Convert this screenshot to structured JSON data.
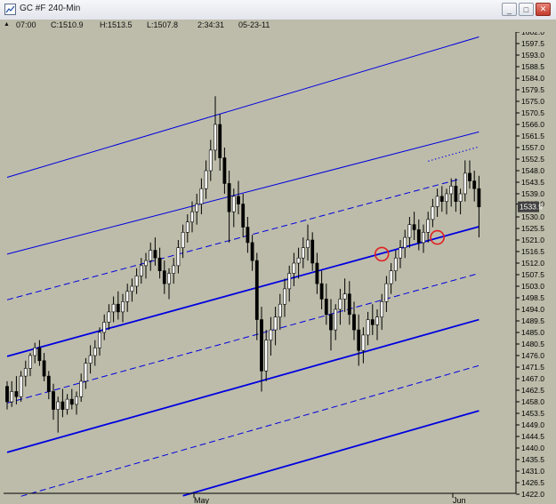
{
  "window": {
    "title": "GC #F 240-Min",
    "buttons": {
      "minimize": "_",
      "maximize": "□",
      "close": "✕"
    }
  },
  "infobar": {
    "time": "07:00",
    "close": "C:1510.9",
    "high": "H:1513.5",
    "low": "L:1507.8",
    "clock": "2:34:31",
    "date": "05-23-11"
  },
  "colors": {
    "background": "#bdbcaa",
    "bars": "#000000",
    "channel": "#0000e0",
    "circles": "#e02020",
    "last_price_box": "#404040"
  },
  "chart_data": {
    "type": "candlestick",
    "symbol": "GC #F",
    "interval": "240-Min",
    "x_labels": [
      "May",
      "Jun"
    ],
    "ylim": [
      1420,
      1604
    ],
    "y_ticks": [
      1602.0,
      1597.5,
      1593.0,
      1588.5,
      1584.0,
      1579.5,
      1575.0,
      1570.5,
      1566.0,
      1561.5,
      1557.0,
      1552.5,
      1548.0,
      1543.5,
      1539.0,
      1535.0,
      1530.0,
      1525.5,
      1521.0,
      1516.5,
      1512.0,
      1507.5,
      1503.0,
      1498.5,
      1494.0,
      1489.5,
      1485.0,
      1480.5,
      1476.0,
      1471.5,
      1467.0,
      1462.5,
      1458.0,
      1453.5,
      1449.0,
      1444.5,
      1440.0,
      1435.5,
      1431.0,
      1426.5,
      1422.0
    ],
    "y_tick_labels": [
      "1602.0",
      "1597.5",
      "1593.0",
      "1588.5",
      "1584.0",
      "1579.5",
      "1575.0",
      "1570.5",
      "1566.0",
      "1561.5",
      "1557.0",
      "1552.5",
      "1548.0",
      "1543.5",
      "1539.0",
      "1535.0",
      "1530.0",
      "1525.5",
      "1521.0",
      "1516.5",
      "1512.0",
      "1507.5",
      "1503.0",
      "1498.5",
      "1494.0",
      "1489.5",
      "1485.0",
      "1480.5",
      "1476.0",
      "1471.5",
      "1467.0",
      "1462.5",
      "1458.0",
      "1453.5",
      "1449.0",
      "1444.5",
      "1440.0",
      "1435.5",
      "1431.0",
      "1426.5",
      "1422.0"
    ],
    "last_price": "1533.9",
    "last_price_value": 1533.9,
    "bars": [
      [
        1464,
        1466,
        1455,
        1458
      ],
      [
        1458,
        1466,
        1456,
        1462
      ],
      [
        1462,
        1468,
        1457,
        1460
      ],
      [
        1460,
        1470,
        1458,
        1468
      ],
      [
        1468,
        1474,
        1464,
        1471
      ],
      [
        1471,
        1477,
        1468,
        1476
      ],
      [
        1476,
        1481,
        1473,
        1479
      ],
      [
        1479,
        1482,
        1472,
        1474
      ],
      [
        1474,
        1477,
        1466,
        1468
      ],
      [
        1468,
        1470,
        1459,
        1462
      ],
      [
        1462,
        1465,
        1451,
        1455
      ],
      [
        1455,
        1460,
        1446,
        1458
      ],
      [
        1458,
        1463,
        1452,
        1455
      ],
      [
        1455,
        1461,
        1453,
        1459
      ],
      [
        1459,
        1463,
        1455,
        1457
      ],
      [
        1457,
        1462,
        1453,
        1460
      ],
      [
        1460,
        1469,
        1458,
        1466
      ],
      [
        1466,
        1475,
        1463,
        1473
      ],
      [
        1473,
        1480,
        1469,
        1476
      ],
      [
        1476,
        1482,
        1472,
        1479
      ],
      [
        1479,
        1487,
        1476,
        1485
      ],
      [
        1485,
        1492,
        1482,
        1489
      ],
      [
        1489,
        1496,
        1486,
        1493
      ],
      [
        1493,
        1499,
        1489,
        1496
      ],
      [
        1496,
        1501,
        1490,
        1493
      ],
      [
        1493,
        1500,
        1489,
        1497
      ],
      [
        1497,
        1504,
        1493,
        1501
      ],
      [
        1501,
        1506,
        1497,
        1503
      ],
      [
        1503,
        1510,
        1500,
        1507
      ],
      [
        1507,
        1514,
        1504,
        1511
      ],
      [
        1511,
        1516,
        1506,
        1513
      ],
      [
        1513,
        1520,
        1509,
        1517
      ],
      [
        1517,
        1522,
        1511,
        1514
      ],
      [
        1514,
        1518,
        1506,
        1509
      ],
      [
        1509,
        1513,
        1500,
        1504
      ],
      [
        1504,
        1510,
        1498,
        1508
      ],
      [
        1508,
        1514,
        1504,
        1511
      ],
      [
        1511,
        1521,
        1508,
        1518
      ],
      [
        1518,
        1527,
        1514,
        1524
      ],
      [
        1524,
        1531,
        1520,
        1528
      ],
      [
        1528,
        1536,
        1524,
        1532
      ],
      [
        1532,
        1539,
        1527,
        1535
      ],
      [
        1535,
        1545,
        1531,
        1541
      ],
      [
        1541,
        1552,
        1537,
        1548
      ],
      [
        1548,
        1560,
        1544,
        1556
      ],
      [
        1556,
        1577,
        1552,
        1566
      ],
      [
        1566,
        1570,
        1548,
        1553
      ],
      [
        1553,
        1557,
        1539,
        1543
      ],
      [
        1543,
        1548,
        1520,
        1532
      ],
      [
        1532,
        1541,
        1526,
        1538
      ],
      [
        1538,
        1544,
        1531,
        1535
      ],
      [
        1535,
        1539,
        1522,
        1526
      ],
      [
        1526,
        1530,
        1516,
        1520
      ],
      [
        1520,
        1523,
        1509,
        1513
      ],
      [
        1513,
        1516,
        1482,
        1490
      ],
      [
        1490,
        1495,
        1462,
        1470
      ],
      [
        1470,
        1486,
        1466,
        1482
      ],
      [
        1482,
        1491,
        1476,
        1486
      ],
      [
        1486,
        1495,
        1480,
        1491
      ],
      [
        1491,
        1500,
        1486,
        1496
      ],
      [
        1496,
        1506,
        1491,
        1502
      ],
      [
        1502,
        1511,
        1497,
        1508
      ],
      [
        1508,
        1516,
        1503,
        1512
      ],
      [
        1512,
        1518,
        1506,
        1514
      ],
      [
        1514,
        1522,
        1510,
        1518
      ],
      [
        1518,
        1527,
        1513,
        1521
      ],
      [
        1521,
        1524,
        1509,
        1512
      ],
      [
        1512,
        1516,
        1500,
        1504
      ],
      [
        1504,
        1509,
        1494,
        1498
      ],
      [
        1498,
        1504,
        1488,
        1492
      ],
      [
        1492,
        1498,
        1478,
        1486
      ],
      [
        1486,
        1496,
        1482,
        1494
      ],
      [
        1494,
        1502,
        1488,
        1498
      ],
      [
        1498,
        1506,
        1493,
        1500
      ],
      [
        1500,
        1505,
        1488,
        1492
      ],
      [
        1492,
        1497,
        1482,
        1486
      ],
      [
        1486,
        1492,
        1472,
        1478
      ],
      [
        1478,
        1487,
        1473,
        1484
      ],
      [
        1484,
        1493,
        1480,
        1490
      ],
      [
        1490,
        1496,
        1484,
        1488
      ],
      [
        1488,
        1494,
        1482,
        1491
      ],
      [
        1491,
        1500,
        1486,
        1497
      ],
      [
        1497,
        1507,
        1493,
        1504
      ],
      [
        1504,
        1512,
        1500,
        1509
      ],
      [
        1509,
        1517,
        1505,
        1514
      ],
      [
        1514,
        1521,
        1510,
        1518
      ],
      [
        1518,
        1525,
        1514,
        1522
      ],
      [
        1522,
        1530,
        1518,
        1527
      ],
      [
        1527,
        1532,
        1521,
        1525
      ],
      [
        1525,
        1529,
        1517,
        1520
      ],
      [
        1520,
        1527,
        1516,
        1524
      ],
      [
        1524,
        1532,
        1520,
        1529
      ],
      [
        1529,
        1537,
        1526,
        1534
      ],
      [
        1534,
        1541,
        1530,
        1538
      ],
      [
        1538,
        1542,
        1532,
        1536
      ],
      [
        1536,
        1541,
        1531,
        1539
      ],
      [
        1539,
        1545,
        1534,
        1542
      ],
      [
        1542,
        1545,
        1532,
        1536
      ],
      [
        1536,
        1541,
        1531,
        1539
      ],
      [
        1539,
        1552,
        1536,
        1547
      ],
      [
        1547,
        1552,
        1541,
        1544
      ],
      [
        1544,
        1548,
        1536,
        1541
      ],
      [
        1541,
        1546,
        1522,
        1533.9
      ]
    ],
    "channel_lines": [
      {
        "style": "solid",
        "weight": "thin",
        "color": "#0000e0",
        "x0": 0,
        "y0": 1545.4,
        "x1": 102,
        "y1": 1600.1
      },
      {
        "style": "solid",
        "weight": "thin",
        "color": "#0000e0",
        "x0": 0,
        "y0": 1515.5,
        "x1": 102,
        "y1": 1563.1
      },
      {
        "style": "dashed",
        "weight": "thin",
        "color": "#0000e0",
        "x0": 0,
        "y0": 1497.7,
        "x1": 98,
        "y1": 1544.8
      },
      {
        "style": "solid",
        "weight": "thick",
        "color": "#0000e0",
        "x0": 0,
        "y0": 1475.7,
        "x1": 102,
        "y1": 1526.2
      },
      {
        "style": "dashed",
        "weight": "thin",
        "color": "#0000e0",
        "x0": 0,
        "y0": 1457.5,
        "x1": 102,
        "y1": 1508.0
      },
      {
        "style": "solid",
        "weight": "thick",
        "color": "#0000e0",
        "x0": 0,
        "y0": 1438.3,
        "x1": 102,
        "y1": 1490.0
      },
      {
        "style": "dashed",
        "weight": "thin",
        "color": "#0000e0",
        "x0": 3,
        "y0": 1421.2,
        "x1": 102,
        "y1": 1472.1
      },
      {
        "style": "solid",
        "weight": "thick",
        "color": "#0000e0",
        "x0": 38,
        "y0": 1421.4,
        "x1": 102,
        "y1": 1454.5
      },
      {
        "style": "dotted",
        "weight": "thin",
        "color": "#0000e0",
        "x0": 91,
        "y0": 1551.7,
        "x1": 102,
        "y1": 1557.3
      }
    ],
    "circles": [
      {
        "x": 81,
        "y": 1515.5,
        "color": "#e02020"
      },
      {
        "x": 93,
        "y": 1522.0,
        "color": "#e02020"
      }
    ]
  }
}
